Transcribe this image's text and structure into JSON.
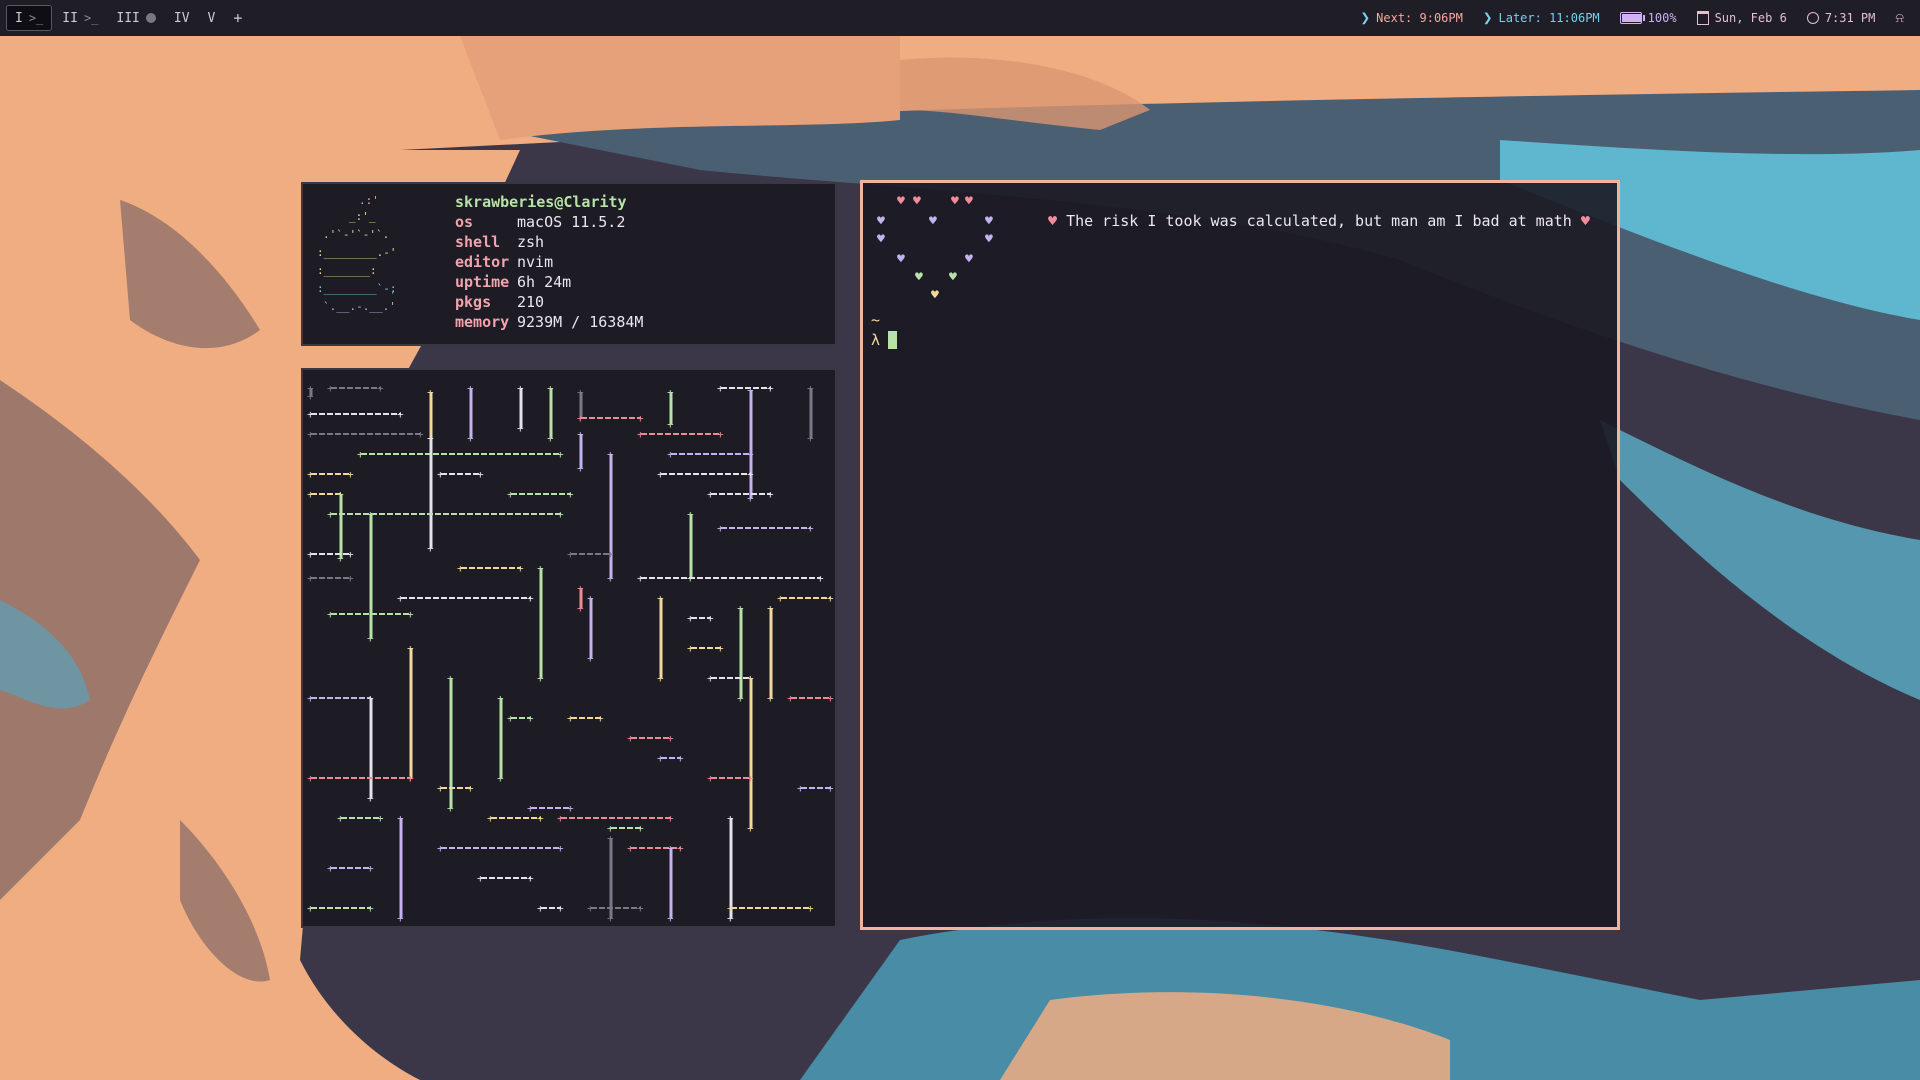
{
  "topbar": {
    "workspaces": [
      {
        "label": "I",
        "glyph": ">_",
        "active": true
      },
      {
        "label": "II",
        "glyph": ">_",
        "active": false
      },
      {
        "label": "III",
        "glyph": "",
        "active": false
      },
      {
        "label": "IV",
        "glyph": "",
        "active": false
      },
      {
        "label": "V",
        "glyph": "",
        "active": false
      }
    ],
    "add_label": "+",
    "next_event": "Next: 9:06PM",
    "later_event": "Later: 11:06PM",
    "battery": "100%",
    "battery_level": 1.0,
    "date": "Sun, Feb 6",
    "time": "7:31 PM"
  },
  "fetch": {
    "user_host": "skrawberies@Clarity",
    "rows": [
      {
        "key": "os",
        "value": "macOS 11.5.2"
      },
      {
        "key": "shell",
        "value": "zsh"
      },
      {
        "key": "editor",
        "value": "nvim"
      },
      {
        "key": "uptime",
        "value": "6h 24m"
      },
      {
        "key": "pkgs",
        "value": "210"
      },
      {
        "key": "memory",
        "value": "9239M / 16384M"
      }
    ]
  },
  "terminal": {
    "quote": "The risk I took was calculated, but man am I bad at math",
    "quote_heart": "♥",
    "cwd": "~",
    "prompt": "λ"
  },
  "colors": {
    "accent_border": "#f3b49c",
    "pipe_green": "#b7e3a8",
    "pipe_yellow": "#f2d89a",
    "pipe_purple": "#c5b2f0",
    "pipe_red": "#ef8a93",
    "pipe_white": "#e6e2ea",
    "pipe_gray": "#7d7887"
  }
}
